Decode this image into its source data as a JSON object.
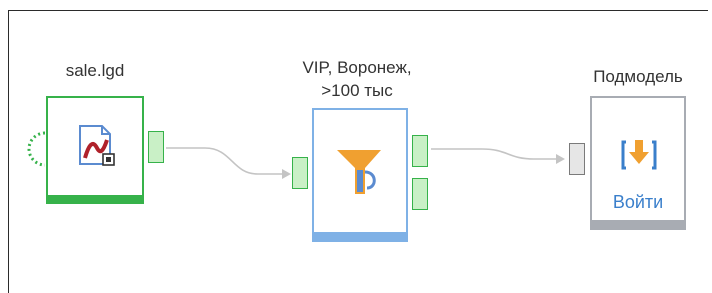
{
  "nodes": [
    {
      "title": "sale.lgd",
      "type": "import",
      "color": "#36b24a"
    },
    {
      "title_line1": "VIP, Воронеж,",
      "title_line2": ">100 тыс",
      "type": "filter",
      "color": "#7fb1e6"
    },
    {
      "title": "Подмодель",
      "type": "submodel",
      "button_label": "Войти",
      "color": "#a8acb3"
    }
  ],
  "colors": {
    "import_border": "#36b24a",
    "filter_border": "#7fb1e6",
    "submodel_border": "#a8acb3",
    "port_green_fill": "#c9f0c6",
    "port_green_stroke": "#36b24a",
    "port_gray_fill": "#e6e6e6",
    "link": "#c4c4c4",
    "accent_orange": "#f0a030",
    "accent_blue": "#3a7fcb"
  },
  "icons": {
    "import": "document-with-curve-icon",
    "filter": "funnel-icon",
    "submodel": "enter-arrow-icon",
    "connector": "dotted-connector-icon"
  }
}
